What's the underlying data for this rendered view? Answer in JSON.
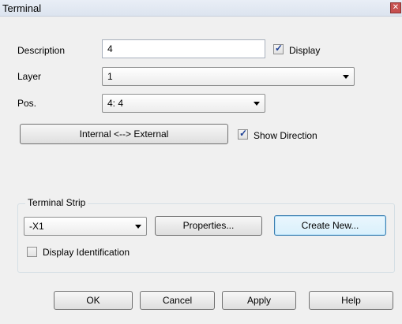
{
  "window": {
    "title": "Terminal",
    "close_label": "✕"
  },
  "description": {
    "label": "Description",
    "value": "4",
    "display_label": "Display",
    "display_checked": true
  },
  "layer": {
    "label": "Layer",
    "value": "1"
  },
  "pos": {
    "label": "Pos.",
    "value": "4: 4"
  },
  "direction": {
    "button_label": "Internal <--> External",
    "show_direction_label": "Show Direction",
    "show_direction_checked": true
  },
  "terminal_strip": {
    "group_label": "Terminal Strip",
    "value": "-X1",
    "properties_label": "Properties...",
    "create_new_label": "Create New...",
    "display_identification_label": "Display Identification",
    "display_identification_checked": false
  },
  "footer": {
    "ok_label": "OK",
    "cancel_label": "Cancel",
    "apply_label": "Apply",
    "help_label": "Help"
  }
}
